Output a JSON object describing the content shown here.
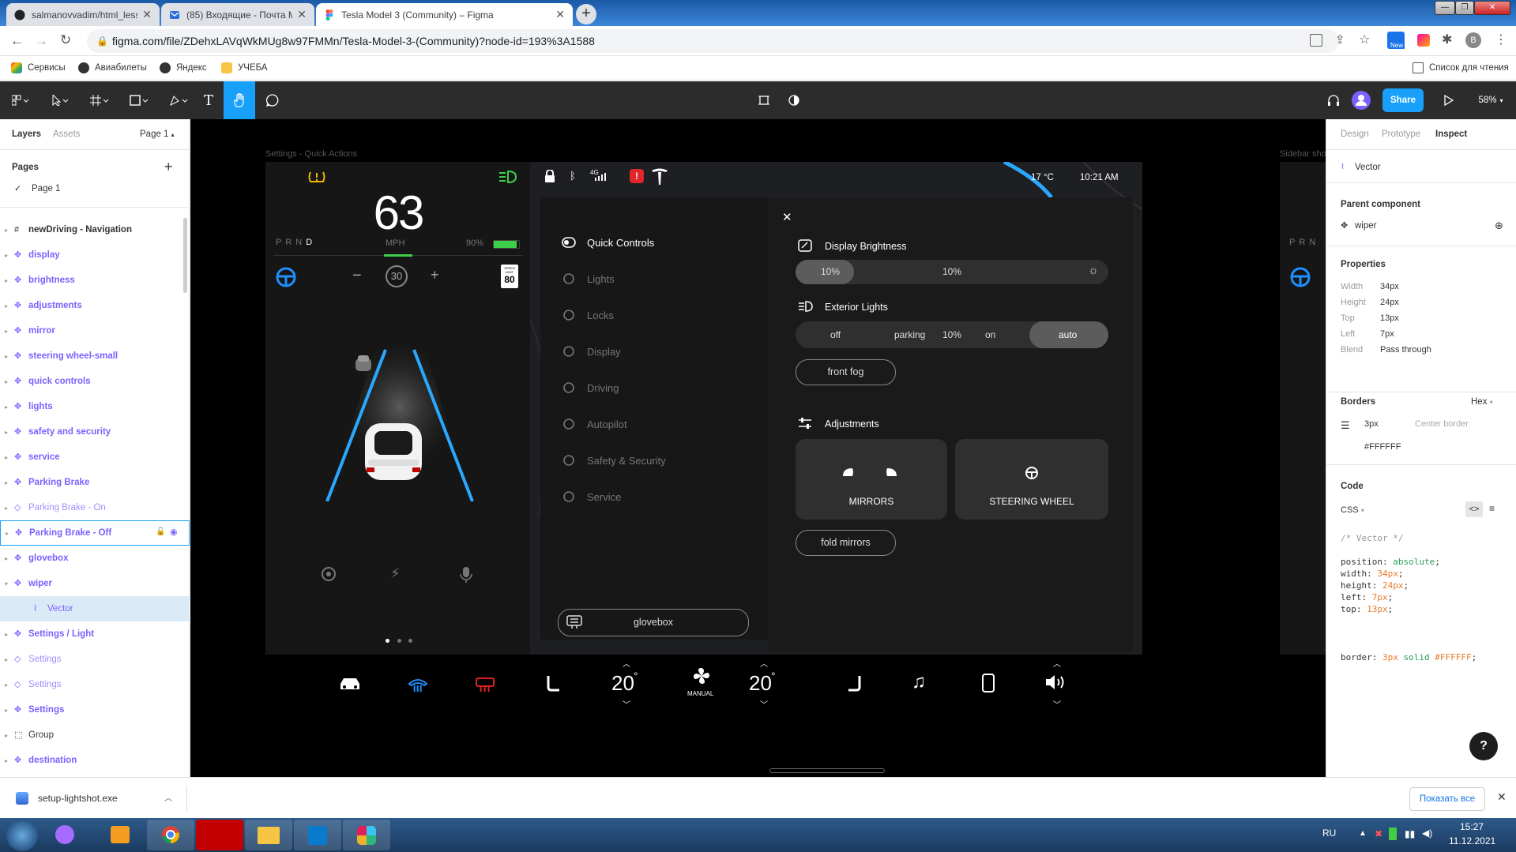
{
  "browser": {
    "tabs": [
      {
        "title": "salmanovvadim/html_lesson6"
      },
      {
        "title": "(85) Входящие - Почта Mail.ru"
      },
      {
        "title": "Tesla Model 3 (Community) – Figma"
      }
    ],
    "url": "figma.com/file/ZDehxLAVqWkMUg8w97FMMn/Tesla-Model-3-(Community)?node-id=193%3A1588",
    "bookmarks": [
      "Сервисы",
      "Авиабилеты",
      "Яндекс",
      "УЧЕБА"
    ],
    "reading_list": "Список для чтения",
    "profile_initial": "В",
    "new_badge": "New"
  },
  "figma": {
    "share": "Share",
    "zoom": "58%",
    "left": {
      "tab_layers": "Layers",
      "tab_assets": "Assets",
      "page_selector": "Page 1",
      "pages_title": "Pages",
      "current_page": "Page 1",
      "layers": [
        {
          "name": "newDriving - Navigation",
          "type": "frame"
        },
        {
          "name": "display",
          "type": "comp"
        },
        {
          "name": "brightness",
          "type": "comp"
        },
        {
          "name": "adjustments",
          "type": "comp"
        },
        {
          "name": "mirror",
          "type": "comp"
        },
        {
          "name": "steering wheel-small",
          "type": "comp"
        },
        {
          "name": "quick controls",
          "type": "comp"
        },
        {
          "name": "lights",
          "type": "comp"
        },
        {
          "name": "safety and security",
          "type": "comp"
        },
        {
          "name": "service",
          "type": "comp"
        },
        {
          "name": "Parking Brake",
          "type": "comp"
        },
        {
          "name": "Parking Brake - On",
          "type": "inst"
        },
        {
          "name": "Parking Brake - Off",
          "type": "comp"
        },
        {
          "name": "glovebox",
          "type": "comp"
        },
        {
          "name": "wiper",
          "type": "comp"
        },
        {
          "name": "Vector",
          "type": "vector"
        },
        {
          "name": "Settings / Light",
          "type": "comp"
        },
        {
          "name": "Settings",
          "type": "inst"
        },
        {
          "name": "Settings",
          "type": "inst"
        },
        {
          "name": "Settings",
          "type": "comp"
        },
        {
          "name": "Group",
          "type": "group"
        },
        {
          "name": "destination",
          "type": "comp"
        }
      ]
    },
    "right": {
      "tabs": [
        "Design",
        "Prototype",
        "Inspect"
      ],
      "layer_name": "Vector",
      "parent_title": "Parent component",
      "parent_name": "wiper",
      "properties_title": "Properties",
      "props": [
        {
          "k": "Width",
          "v": "34px"
        },
        {
          "k": "Height",
          "v": "24px"
        },
        {
          "k": "Top",
          "v": "13px"
        },
        {
          "k": "Left",
          "v": "7px"
        },
        {
          "k": "Blend",
          "v": "Pass through"
        }
      ],
      "borders_title": "Borders",
      "color_mode": "Hex",
      "border_width": "3px",
      "border_pos": "Center border",
      "border_color": "#FFFFFF",
      "code_title": "Code",
      "code_lang": "CSS",
      "code": {
        "comment": "/* Vector */",
        "lines": [
          {
            "p": "position:",
            "v": "absolute",
            "t": "green"
          },
          {
            "p": "width:",
            "v": "34px",
            "t": "orange"
          },
          {
            "p": "height:",
            "v": "24px",
            "t": "orange"
          },
          {
            "p": "left:",
            "v": "7px",
            "t": "orange"
          },
          {
            "p": "top:",
            "v": "13px",
            "t": "orange"
          }
        ],
        "border_prop": "border:",
        "border_val_1": "3px",
        "border_val_2": "solid",
        "border_val_3": "#FFFFFF"
      }
    },
    "canvas": {
      "frame_label_1": "Settings - Quick Actions",
      "frame_label_2": "Sidebar sho"
    }
  },
  "tesla": {
    "speed": "63",
    "gears": [
      "P",
      "R",
      "N",
      "D"
    ],
    "unit": "MPH",
    "battery": "90%",
    "cruise": "30",
    "limit_label": "SPEED LIMIT",
    "limit": "80",
    "temp": "17 °C",
    "time": "10:21 AM",
    "net": "4G",
    "menu": [
      {
        "label": "Quick Controls",
        "on": true
      },
      {
        "label": "Lights",
        "on": false
      },
      {
        "label": "Locks",
        "on": false
      },
      {
        "label": "Display",
        "on": false
      },
      {
        "label": "Driving",
        "on": false
      },
      {
        "label": "Autopilot",
        "on": false
      },
      {
        "label": "Safety & Security",
        "on": false
      },
      {
        "label": "Service",
        "on": false
      }
    ],
    "glovebox": "glovebox",
    "close": "✕",
    "display_brightness": "Display Brightness",
    "brightness_a": "10%",
    "brightness_b": "10%",
    "brightness_level": 0.1,
    "exterior_lights": "Exterior Lights",
    "lights_opts": [
      "off",
      "parking",
      "10%",
      "on",
      "auto"
    ],
    "lights_selected": "auto",
    "front_fog": "front fog",
    "adjustments": "Adjustments",
    "mirrors": "MIRRORS",
    "steering": "STEERING WHEEL",
    "fold_mirrors": "fold mirrors",
    "climate_left": "20",
    "climate_right": "20",
    "deg": "°",
    "fan_mode": "MANUAL"
  },
  "downloads": {
    "file": "setup-lightshot.exe",
    "show_all": "Показать все"
  },
  "taskbar": {
    "lang": "RU",
    "time": "15:27",
    "date": "11.12.2021"
  }
}
